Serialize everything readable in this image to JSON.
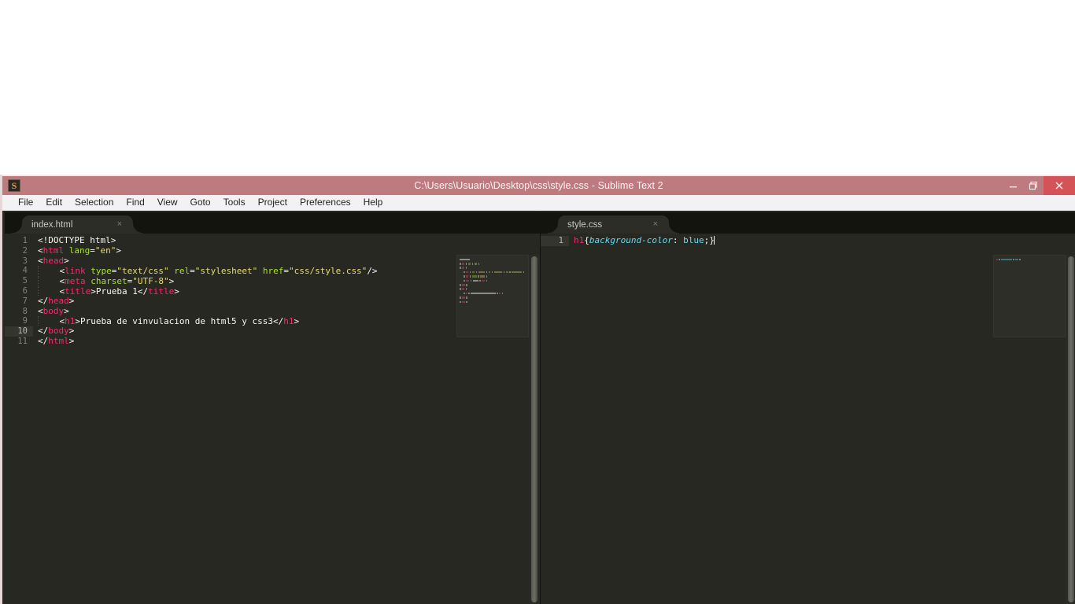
{
  "window": {
    "title": "C:\\Users\\Usuario\\Desktop\\css\\style.css - Sublime Text 2",
    "icon": "sublime-text-icon",
    "titlebar_color": "#bd7b80",
    "close_button_color": "#d35356",
    "controls": {
      "minimize": "minimize-icon",
      "restore": "restore-icon",
      "close": "close-icon"
    }
  },
  "menu": {
    "items": [
      {
        "label": "File"
      },
      {
        "label": "Edit"
      },
      {
        "label": "Selection"
      },
      {
        "label": "Find"
      },
      {
        "label": "View"
      },
      {
        "label": "Goto"
      },
      {
        "label": "Tools"
      },
      {
        "label": "Project"
      },
      {
        "label": "Preferences"
      },
      {
        "label": "Help"
      }
    ]
  },
  "editor": {
    "theme_background": "#272822",
    "panes": [
      {
        "id": "left",
        "tab": {
          "label": "index.html",
          "close_label": "×"
        },
        "active_line": 10,
        "line_numbers": [
          "1",
          "2",
          "3",
          "4",
          "5",
          "6",
          "7",
          "8",
          "9",
          "10",
          "11"
        ],
        "lines": [
          {
            "n": 1,
            "indent": 0,
            "tokens": [
              {
                "t": "plain",
                "v": "<!DOCTYPE html>"
              }
            ]
          },
          {
            "n": 2,
            "indent": 0,
            "tokens": [
              {
                "t": "punc",
                "v": "<"
              },
              {
                "t": "tag",
                "v": "html"
              },
              {
                "t": "plain",
                "v": " "
              },
              {
                "t": "attr",
                "v": "lang"
              },
              {
                "t": "punc",
                "v": "="
              },
              {
                "t": "str",
                "v": "\"en\""
              },
              {
                "t": "punc",
                "v": ">"
              }
            ]
          },
          {
            "n": 3,
            "indent": 0,
            "tokens": [
              {
                "t": "punc",
                "v": "<"
              },
              {
                "t": "tag",
                "v": "head"
              },
              {
                "t": "punc",
                "v": ">"
              }
            ]
          },
          {
            "n": 4,
            "indent": 1,
            "tokens": [
              {
                "t": "punc",
                "v": "<"
              },
              {
                "t": "tag",
                "v": "link"
              },
              {
                "t": "plain",
                "v": " "
              },
              {
                "t": "attr",
                "v": "type"
              },
              {
                "t": "punc",
                "v": "="
              },
              {
                "t": "str",
                "v": "\"text/css\""
              },
              {
                "t": "plain",
                "v": " "
              },
              {
                "t": "attr",
                "v": "rel"
              },
              {
                "t": "punc",
                "v": "="
              },
              {
                "t": "str",
                "v": "\"stylesheet\""
              },
              {
                "t": "plain",
                "v": " "
              },
              {
                "t": "attr",
                "v": "href"
              },
              {
                "t": "punc",
                "v": "="
              },
              {
                "t": "str",
                "v": "\"css/style.css\""
              },
              {
                "t": "punc",
                "v": "/>"
              }
            ]
          },
          {
            "n": 5,
            "indent": 1,
            "tokens": [
              {
                "t": "punc",
                "v": "<"
              },
              {
                "t": "tag",
                "v": "meta"
              },
              {
                "t": "plain",
                "v": " "
              },
              {
                "t": "attr",
                "v": "charset"
              },
              {
                "t": "punc",
                "v": "="
              },
              {
                "t": "str",
                "v": "\"UTF-8\""
              },
              {
                "t": "punc",
                "v": ">"
              }
            ]
          },
          {
            "n": 6,
            "indent": 1,
            "tokens": [
              {
                "t": "punc",
                "v": "<"
              },
              {
                "t": "tag",
                "v": "title"
              },
              {
                "t": "punc",
                "v": ">"
              },
              {
                "t": "plain",
                "v": "Prueba 1"
              },
              {
                "t": "punc",
                "v": "</"
              },
              {
                "t": "tag",
                "v": "title"
              },
              {
                "t": "punc",
                "v": ">"
              }
            ]
          },
          {
            "n": 7,
            "indent": 0,
            "tokens": [
              {
                "t": "punc",
                "v": "</"
              },
              {
                "t": "tag",
                "v": "head"
              },
              {
                "t": "punc",
                "v": ">"
              }
            ]
          },
          {
            "n": 8,
            "indent": 0,
            "tokens": [
              {
                "t": "punc",
                "v": "<"
              },
              {
                "t": "tag",
                "v": "body"
              },
              {
                "t": "punc",
                "v": ">"
              }
            ]
          },
          {
            "n": 9,
            "indent": 1,
            "tokens": [
              {
                "t": "punc",
                "v": "<"
              },
              {
                "t": "tag",
                "v": "h1"
              },
              {
                "t": "punc",
                "v": ">"
              },
              {
                "t": "plain",
                "v": "Prueba de vinvulacion de html5 y css3"
              },
              {
                "t": "punc",
                "v": "</"
              },
              {
                "t": "tag",
                "v": "h1"
              },
              {
                "t": "punc",
                "v": ">"
              }
            ]
          },
          {
            "n": 10,
            "indent": 0,
            "tokens": [
              {
                "t": "punc",
                "v": "</"
              },
              {
                "t": "tag",
                "v": "body"
              },
              {
                "t": "punc",
                "v": ">"
              }
            ]
          },
          {
            "n": 11,
            "indent": 0,
            "tokens": [
              {
                "t": "punc",
                "v": "</"
              },
              {
                "t": "tag",
                "v": "html"
              },
              {
                "t": "punc",
                "v": ">"
              }
            ]
          }
        ]
      },
      {
        "id": "right",
        "tab": {
          "label": "style.css",
          "close_label": "×"
        },
        "active_line": 1,
        "line_numbers": [
          "1"
        ],
        "lines": [
          {
            "n": 1,
            "indent": 0,
            "caret": true,
            "tokens": [
              {
                "t": "tag",
                "v": "h1"
              },
              {
                "t": "punc",
                "v": "{"
              },
              {
                "t": "prop",
                "v": "background-color"
              },
              {
                "t": "punc",
                "v": ": "
              },
              {
                "t": "val",
                "v": "blue"
              },
              {
                "t": "punc",
                "v": ";}"
              }
            ]
          }
        ]
      }
    ],
    "syntax_colors": {
      "tag": "#f92672",
      "attribute": "#a6e22e",
      "string": "#e6db74",
      "plain": "#f8f8f2",
      "property": "#66d9ef",
      "value": "#66d9ef"
    }
  }
}
